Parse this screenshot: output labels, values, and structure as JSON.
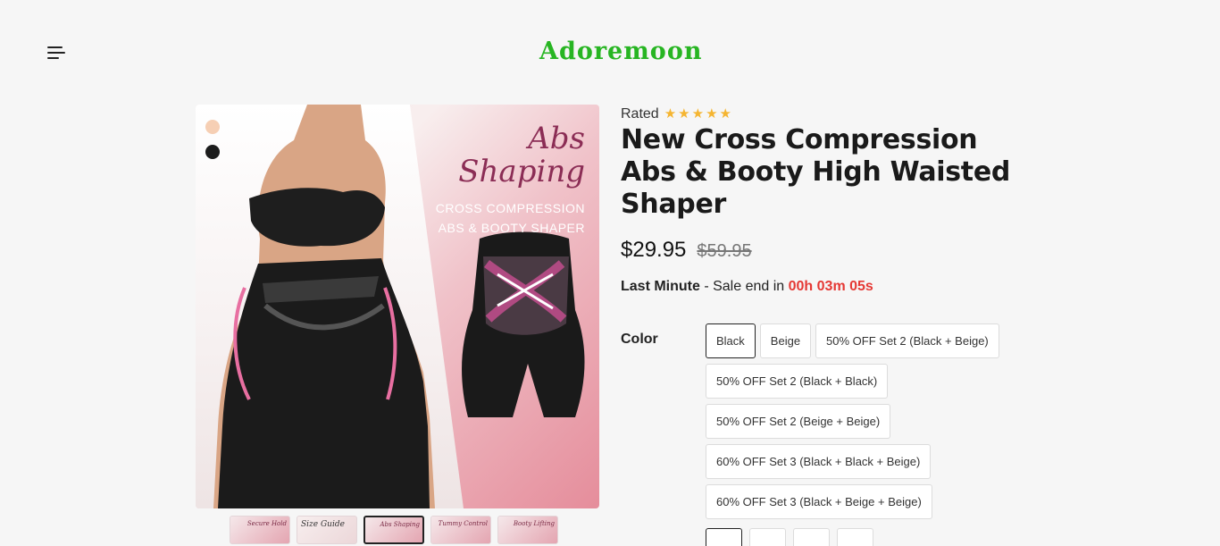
{
  "header": {
    "logo_text": "Adoremoon",
    "menu_icon": "hamburger-menu-icon",
    "brand_color": "#27b522"
  },
  "gallery": {
    "swatches": [
      {
        "name": "beige",
        "color": "#f6cfb4"
      },
      {
        "name": "black",
        "color": "#1c1c1c"
      }
    ],
    "headline_script": "Abs Shaping",
    "headline_line1": "CROSS COMPRESSION",
    "headline_line2": "ABS & BOOTY SHAPER",
    "thumbnails": [
      {
        "label": "Secure Hold"
      },
      {
        "label": "Size Guide"
      },
      {
        "label": "Abs Shaping",
        "active": true
      },
      {
        "label": "Tummy Control"
      },
      {
        "label": "Booty Lifting"
      }
    ]
  },
  "product": {
    "rated_label": "Rated",
    "rating_stars": 5,
    "title": "New Cross Compression Abs & Booty High Waisted Shaper",
    "price": "$29.95",
    "price_old": "$59.95",
    "sale_strong": "Last Minute",
    "sale_text": " - Sale end in ",
    "sale_timer": "00h 03m 05s",
    "timer_color": "#e53935"
  },
  "color_selector": {
    "label": "Color",
    "options": [
      {
        "label": "Black",
        "selected": true
      },
      {
        "label": "Beige"
      },
      {
        "label": "50% OFF Set 2 (Black + Beige)"
      },
      {
        "label": "50% OFF Set 2 (Black + Black)"
      },
      {
        "label": "50% OFF Set 2 (Beige + Beige)"
      },
      {
        "label": "60% OFF Set 3 (Black + Black + Beige)"
      },
      {
        "label": "60% OFF Set 3 (Black + Beige + Beige)"
      }
    ]
  }
}
